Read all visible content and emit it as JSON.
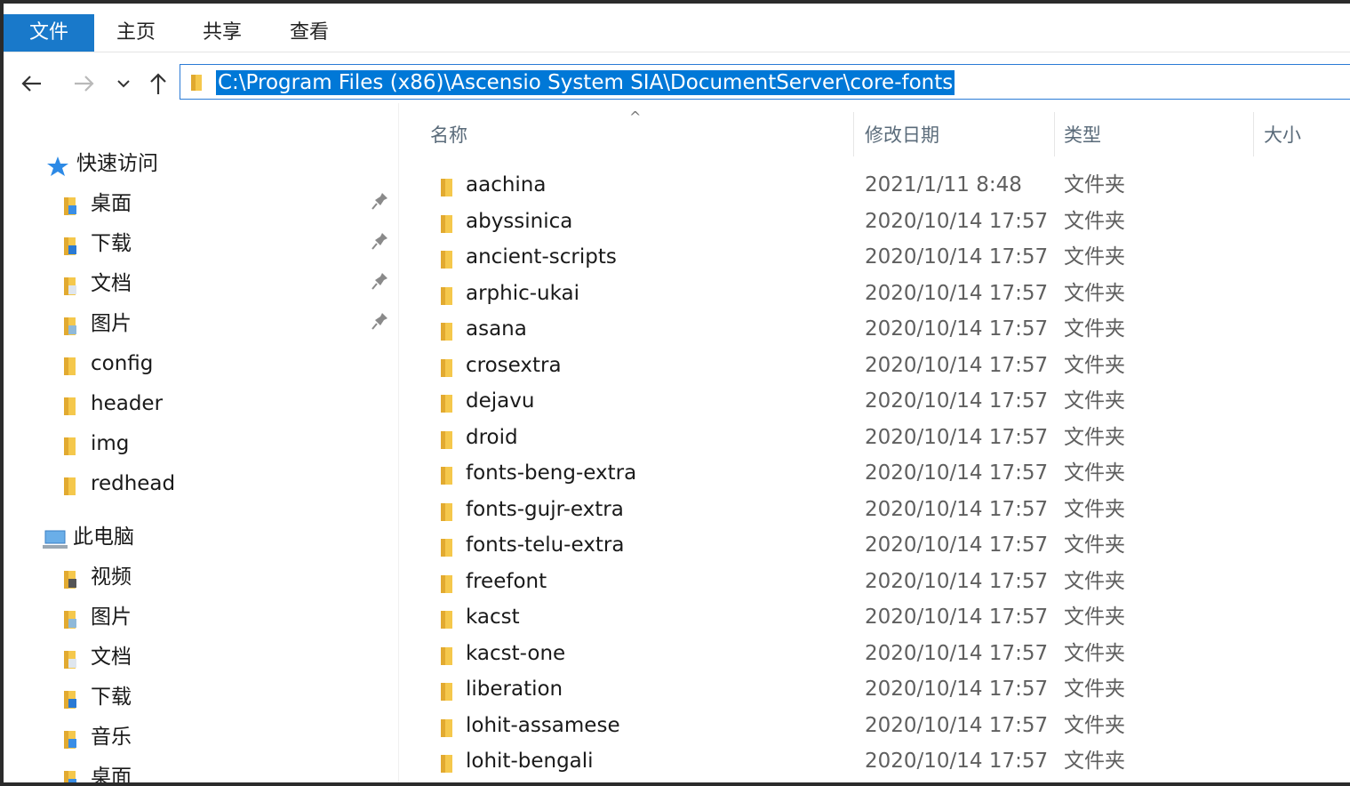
{
  "ribbon": {
    "tabs": [
      "文件",
      "主页",
      "共享",
      "查看"
    ]
  },
  "address": {
    "path": "C:\\Program Files (x86)\\Ascensio System SIA\\DocumentServer\\core-fonts"
  },
  "columns": {
    "name": "名称",
    "modified": "修改日期",
    "type": "类型",
    "size": "大小"
  },
  "nav": {
    "quick_access": "快速访问",
    "quick_items": [
      {
        "label": "桌面",
        "icon": "desktop-folder-icon",
        "pinned": true
      },
      {
        "label": "下载",
        "icon": "download-folder-icon",
        "pinned": true
      },
      {
        "label": "文档",
        "icon": "documents-folder-icon",
        "pinned": true
      },
      {
        "label": "图片",
        "icon": "pictures-folder-icon",
        "pinned": true
      },
      {
        "label": "config",
        "icon": "folder-icon",
        "pinned": false
      },
      {
        "label": "header",
        "icon": "folder-icon",
        "pinned": false
      },
      {
        "label": "img",
        "icon": "folder-icon",
        "pinned": false
      },
      {
        "label": "redhead",
        "icon": "folder-icon",
        "pinned": false
      }
    ],
    "this_pc": "此电脑",
    "pc_items": [
      {
        "label": "视频",
        "icon": "videos-folder-icon"
      },
      {
        "label": "图片",
        "icon": "pictures-folder-icon"
      },
      {
        "label": "文档",
        "icon": "documents-folder-icon"
      },
      {
        "label": "下载",
        "icon": "download-folder-icon"
      },
      {
        "label": "音乐",
        "icon": "music-folder-icon"
      },
      {
        "label": "桌面",
        "icon": "desktop-folder-icon"
      }
    ]
  },
  "files": [
    {
      "name": "aachina",
      "date": "2021/1/11 8:48",
      "type": "文件夹"
    },
    {
      "name": "abyssinica",
      "date": "2020/10/14 17:57",
      "type": "文件夹"
    },
    {
      "name": "ancient-scripts",
      "date": "2020/10/14 17:57",
      "type": "文件夹"
    },
    {
      "name": "arphic-ukai",
      "date": "2020/10/14 17:57",
      "type": "文件夹"
    },
    {
      "name": "asana",
      "date": "2020/10/14 17:57",
      "type": "文件夹"
    },
    {
      "name": "crosextra",
      "date": "2020/10/14 17:57",
      "type": "文件夹"
    },
    {
      "name": "dejavu",
      "date": "2020/10/14 17:57",
      "type": "文件夹"
    },
    {
      "name": "droid",
      "date": "2020/10/14 17:57",
      "type": "文件夹"
    },
    {
      "name": "fonts-beng-extra",
      "date": "2020/10/14 17:57",
      "type": "文件夹"
    },
    {
      "name": "fonts-gujr-extra",
      "date": "2020/10/14 17:57",
      "type": "文件夹"
    },
    {
      "name": "fonts-telu-extra",
      "date": "2020/10/14 17:57",
      "type": "文件夹"
    },
    {
      "name": "freefont",
      "date": "2020/10/14 17:57",
      "type": "文件夹"
    },
    {
      "name": "kacst",
      "date": "2020/10/14 17:57",
      "type": "文件夹"
    },
    {
      "name": "kacst-one",
      "date": "2020/10/14 17:57",
      "type": "文件夹"
    },
    {
      "name": "liberation",
      "date": "2020/10/14 17:57",
      "type": "文件夹"
    },
    {
      "name": "lohit-assamese",
      "date": "2020/10/14 17:57",
      "type": "文件夹"
    },
    {
      "name": "lohit-bengali",
      "date": "2020/10/14 17:57",
      "type": "文件夹"
    }
  ],
  "colors": {
    "accent": "#1979ca",
    "selection": "#0078d7",
    "folder": "#f5c84c"
  }
}
